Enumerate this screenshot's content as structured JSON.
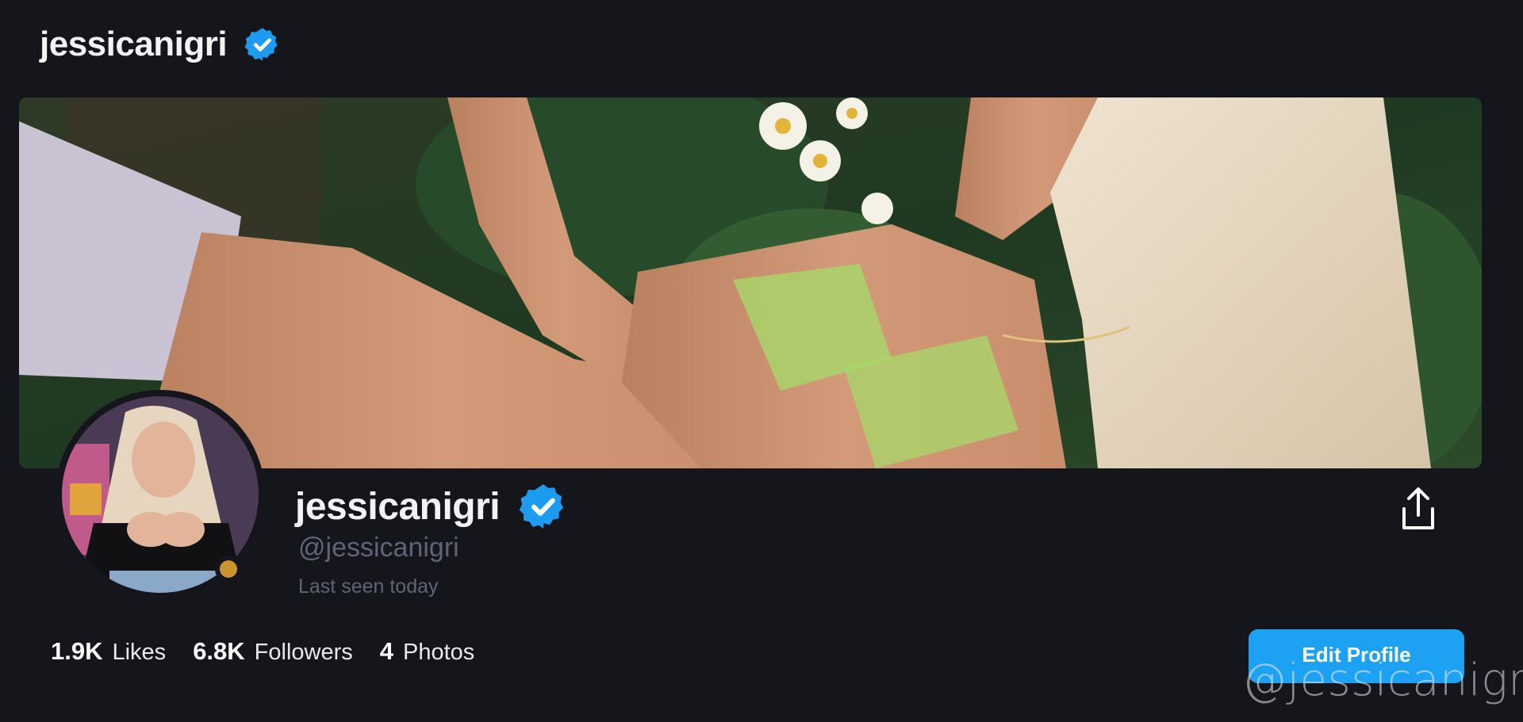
{
  "header": {
    "title": "jessicanigri",
    "verified_icon": "verified-badge-icon"
  },
  "profile": {
    "display_name": "jessicanigri",
    "handle": "@jessicanigri",
    "last_seen": "Last seen today",
    "status_color": "#c9932f"
  },
  "stats": [
    {
      "value": "1.9K",
      "label": "Likes"
    },
    {
      "value": "6.8K",
      "label": "Followers"
    },
    {
      "value": "4",
      "label": "Photos"
    }
  ],
  "actions": {
    "edit_profile_label": "Edit Profile",
    "share_icon": "share-icon"
  },
  "watermark": "@jessicanigri",
  "colors": {
    "background": "#15161b",
    "accent": "#1da1f2",
    "muted_text": "#5f6476"
  }
}
